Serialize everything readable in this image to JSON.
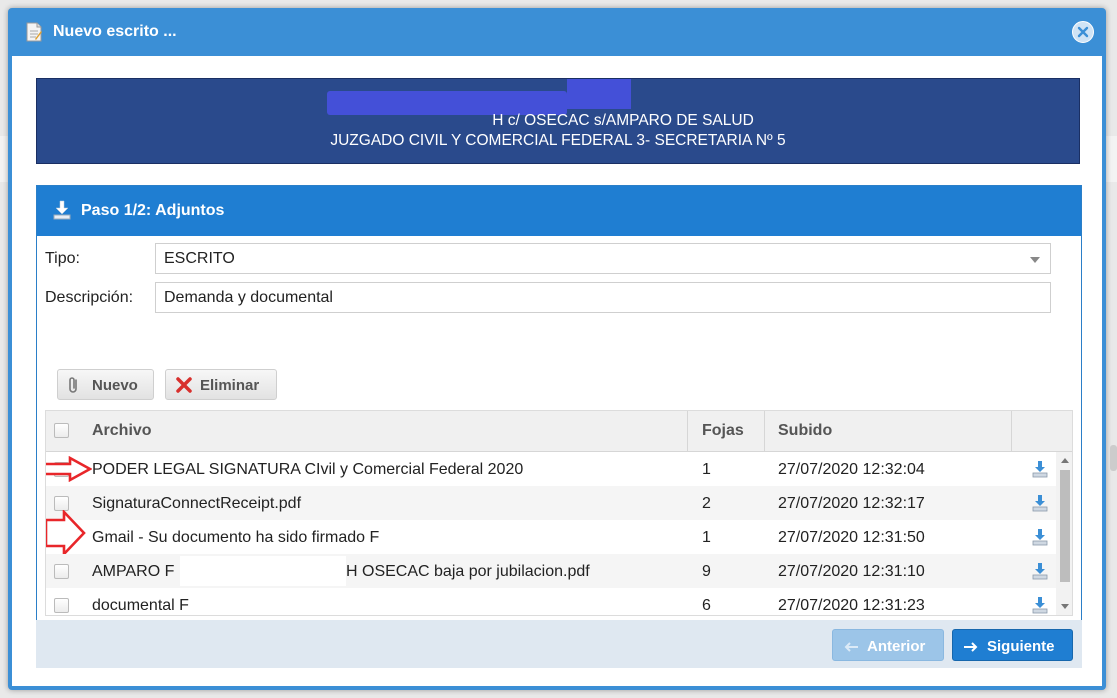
{
  "dialog": {
    "title": "Nuevo escrito ..."
  },
  "case": {
    "line1": "H c/ OSECAC s/AMPARO DE SALUD",
    "line2": "JUZGADO CIVIL Y COMERCIAL FEDERAL 3- SECRETARIA Nº 5"
  },
  "step": {
    "title": "Paso 1/2: Adjuntos"
  },
  "form": {
    "tipo_label": "Tipo:",
    "tipo_value": "ESCRITO",
    "descripcion_label": "Descripción:",
    "descripcion_value": "Demanda y documental"
  },
  "toolbar": {
    "nuevo_label": "Nuevo",
    "eliminar_label": "Eliminar"
  },
  "grid": {
    "columns": {
      "archivo": "Archivo",
      "fojas": "Fojas",
      "subido": "Subido"
    },
    "rows": [
      {
        "archivo": "PODER LEGAL SIGNATURA CIvil y Comercial Federal 2020",
        "fojas": "1",
        "subido": "27/07/2020 12:32:04"
      },
      {
        "archivo": "SignaturaConnectReceipt.pdf",
        "fojas": "2",
        "subido": "27/07/2020 12:32:17"
      },
      {
        "archivo": "Gmail - Su documento ha sido firmado F",
        "fojas": "1",
        "subido": "27/07/2020 12:31:50"
      },
      {
        "archivo": "AMPARO F",
        "archivo_suffix": "H OSECAC baja por jubilacion.pdf",
        "fojas": "9",
        "subido": "27/07/2020 12:31:10"
      },
      {
        "archivo": "documental F",
        "fojas": "6",
        "subido": "27/07/2020 12:31:23"
      }
    ]
  },
  "footer": {
    "prev_label": "Anterior",
    "next_label": "Siguiente"
  },
  "colors": {
    "dialog_blue": "#3b8fd6",
    "case_header": "#2a4a8c",
    "step_header": "#1f7ed2",
    "annotation_red": "#e8262a"
  },
  "icons": [
    "document-icon",
    "close-icon",
    "download-icon",
    "paperclip-icon",
    "delete-x-icon",
    "arrow-left-icon",
    "arrow-right-icon",
    "red-arrow-annotation"
  ]
}
